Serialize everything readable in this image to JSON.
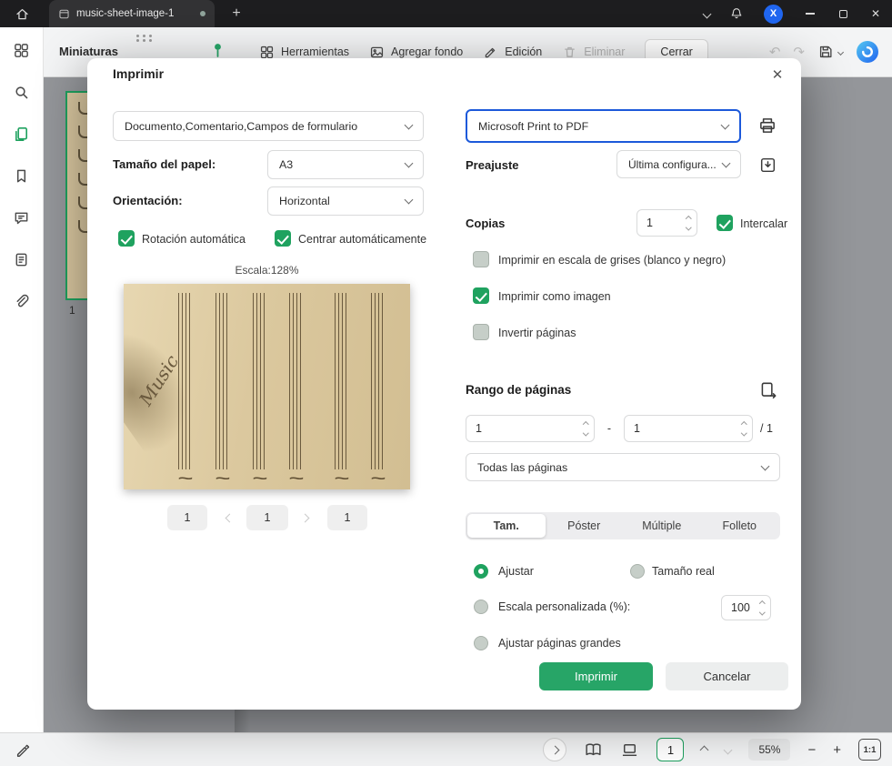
{
  "titlebar": {
    "tab_title": "music-sheet-image-1",
    "new_tab_label": "+",
    "avatar_letter": "X",
    "close_glyph": "✕"
  },
  "toolbar": {
    "panel_title": "Miniaturas",
    "tools_label": "Herramientas",
    "add_background_label": "Agregar fondo",
    "edit_label": "Edición",
    "delete_label": "Eliminar",
    "close_label": "Cerrar",
    "undo_glyph": "↶",
    "redo_glyph": "↷"
  },
  "thumbnail_panel": {
    "page_number": "1"
  },
  "print_dialog": {
    "title": "Imprimir",
    "content_select_value": "Documento,Comentario,Campos de formulario",
    "paper_size_label": "Tamaño del papel:",
    "paper_size_value": "A3",
    "orientation_label": "Orientación:",
    "orientation_value": "Horizontal",
    "auto_rotate_label": "Rotación automática",
    "auto_center_label": "Centrar automáticamente",
    "scale_text": "Escala:128%",
    "preview_word": "Music",
    "pager_first": "1",
    "pager_current": "1",
    "pager_last": "1",
    "printer_value": "Microsoft Print to PDF",
    "preset_label": "Preajuste",
    "preset_value": "Última configura...",
    "copies_label": "Copias",
    "copies_value": "1",
    "collate_label": "Intercalar",
    "grayscale_label": "Imprimir en escala de grises (blanco y negro)",
    "print_as_image_label": "Imprimir como imagen",
    "reverse_pages_label": "Invertir páginas",
    "range_label": "Rango de páginas",
    "range_from": "1",
    "range_sep": "-",
    "range_to": "1",
    "range_total": "/ 1",
    "pages_select_value": "Todas las páginas",
    "tabs": [
      "Tam.",
      "Póster",
      "Múltiple",
      "Folleto"
    ],
    "fit_label": "Ajustar",
    "actual_size_label": "Tamaño real",
    "custom_scale_label": "Escala personalizada (%):",
    "custom_scale_value": "100",
    "fit_large_label": "Ajustar páginas grandes",
    "print_button": "Imprimir",
    "cancel_button": "Cancelar"
  },
  "statusbar": {
    "page_value": "1",
    "zoom_value": "55%",
    "zoom_out_glyph": "−",
    "zoom_in_glyph": "+",
    "ratio_label": "1:1"
  },
  "colors": {
    "accent_green": "#1fa25f",
    "focus_blue": "#1c59da",
    "paper_beige": "#d8c69f"
  }
}
